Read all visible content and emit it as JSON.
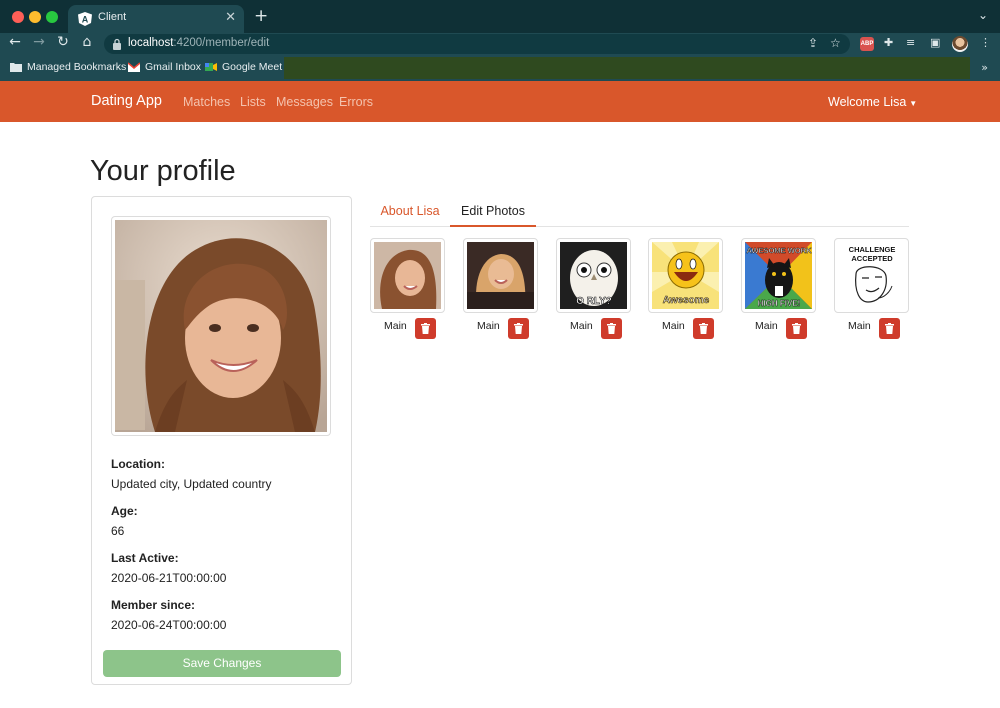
{
  "browser": {
    "tab_title": "Client",
    "url_host": "localhost",
    "url_rest": ":4200/member/edit",
    "bookmarks": [
      "Managed Bookmarks",
      "Gmail Inbox",
      "Google Meet"
    ],
    "abp_label": "ABP"
  },
  "navbar": {
    "brand": "Dating App",
    "links": [
      "Matches",
      "Lists",
      "Messages",
      "Errors"
    ],
    "welcome": "Welcome Lisa",
    "accent_color": "#d9572b"
  },
  "page": {
    "title": "Your profile"
  },
  "profile_card": {
    "fields": [
      {
        "label": "Location:",
        "value": "Updated city, Updated country"
      },
      {
        "label": "Age:",
        "value": "66"
      },
      {
        "label": "Last Active:",
        "value": "2020-06-21T00:00:00"
      },
      {
        "label": "Member since:",
        "value": "2020-06-24T00:00:00"
      }
    ],
    "save_label": "Save Changes"
  },
  "tabs": {
    "about": "About Lisa",
    "edit_photos": "Edit Photos",
    "active": "edit_photos"
  },
  "photos": [
    {
      "name": "lisa-photo-1",
      "main_label": "Main"
    },
    {
      "name": "lisa-photo-2",
      "main_label": "Main"
    },
    {
      "name": "owl-orly",
      "main_label": "Main",
      "caption": "O RLY?"
    },
    {
      "name": "awesome-face",
      "main_label": "Main",
      "caption": "Awesome"
    },
    {
      "name": "business-cat",
      "main_label": "Main",
      "caption_top": "AWESOME WORK",
      "caption_bottom": "HIGH FIVE!"
    },
    {
      "name": "challenge-accepted",
      "main_label": "Main",
      "caption_top": "CHALLENGE",
      "caption_bottom": "ACCEPTED"
    }
  ]
}
